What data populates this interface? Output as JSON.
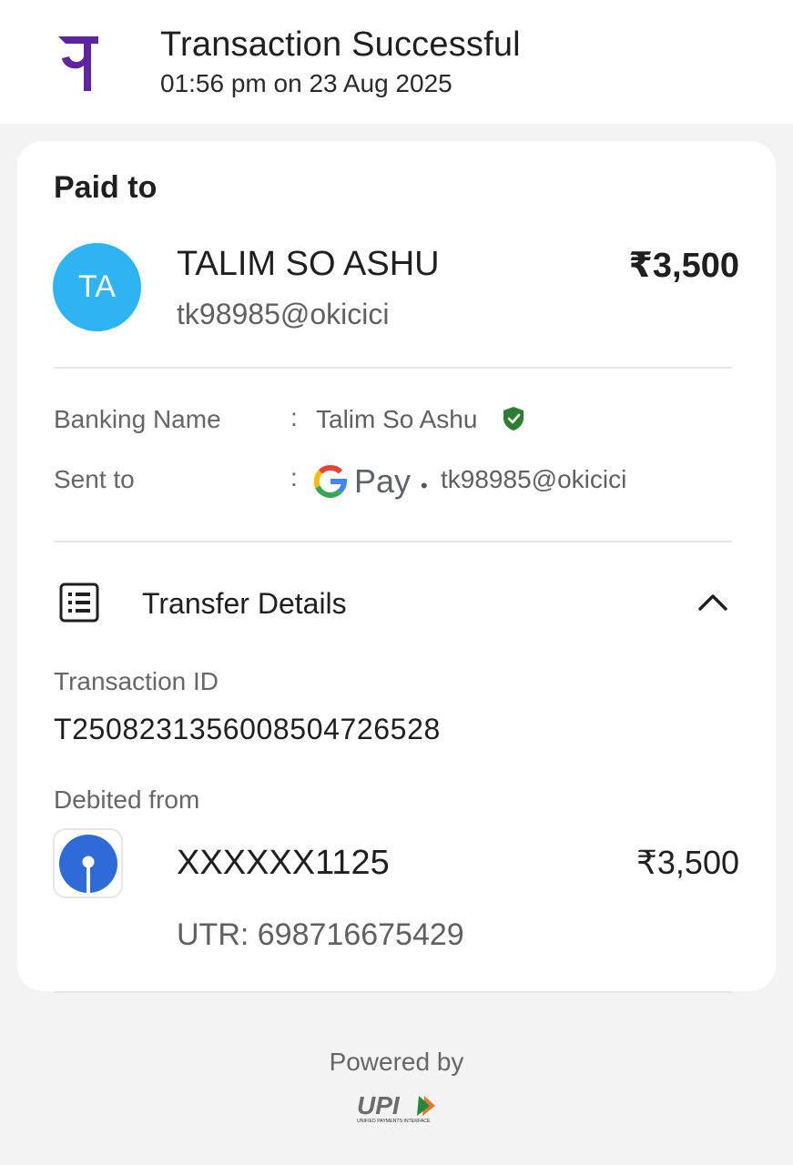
{
  "header": {
    "title": "Transaction Successful",
    "datetime": "01:56 pm on 23 Aug 2025",
    "app_logo_icon": "phonepe-logo-icon",
    "brand_color": "#5f259f"
  },
  "payment": {
    "section_label": "Paid to",
    "avatar_initials": "TA",
    "avatar_color": "#2eb4f0",
    "payee_name": "TALIM SO ASHU",
    "payee_vpa": "tk98985@okicici",
    "amount": "₹3,500"
  },
  "details": {
    "banking_name_label": "Banking Name",
    "banking_name_value": "Talim So Ashu",
    "verified_icon": "shield-check-icon",
    "sent_to_label": "Sent to",
    "sent_to_app": "Pay",
    "sent_to_dot": "•",
    "sent_to_vpa": "tk98985@okicici",
    "colon": ":"
  },
  "transfer": {
    "title": "Transfer Details",
    "transaction_id_label": "Transaction ID",
    "transaction_id": "T2508231356008504726528",
    "debited_from_label": "Debited from",
    "account": "XXXXXX1125",
    "debit_amount": "₹3,500",
    "utr": "UTR: 698716675429"
  },
  "footer": {
    "powered_by": "Powered by",
    "upi_logo_text": "UPI",
    "upi_tagline": "UNIFIED PAYMENTS INTERFACE"
  }
}
